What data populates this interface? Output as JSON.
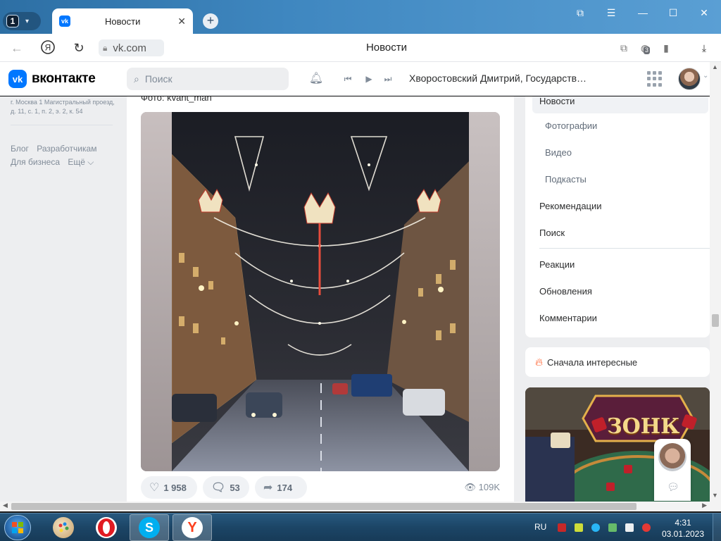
{
  "browser": {
    "tab_count": "1",
    "tab_title": "Новости",
    "tab_close": "✕",
    "new_tab": "+",
    "url_host": "vk.com",
    "page_title": "Новости",
    "extensions_badge": "3"
  },
  "vk_header": {
    "logo_letter": "vk",
    "brand": "вконтакте",
    "search_placeholder": "Поиск",
    "now_playing": "Хворостовский Дмитрий, Государств…"
  },
  "left_column": {
    "address": "г. Москва 1 Магистральный проезд, д. 11, с. 1, п. 2, э. 2, к. 54",
    "links": [
      "Блог",
      "Разработчикам",
      "Для бизнеса",
      "Ещё ⌵"
    ]
  },
  "post": {
    "photo_caption": "Фото: kvant_man",
    "likes": "1 958",
    "comments": "53",
    "shares": "174",
    "views": "109K"
  },
  "right_menu": {
    "items": [
      {
        "label": "Новости"
      },
      {
        "label": "Фотографии"
      },
      {
        "label": "Видео"
      },
      {
        "label": "Подкасты"
      },
      {
        "label": "Рекомендации"
      },
      {
        "label": "Поиск"
      },
      {
        "label": "Реакции"
      },
      {
        "label": "Обновления"
      },
      {
        "label": "Комментарии"
      }
    ],
    "sort_label": "Сначала интересные"
  },
  "ad": {
    "title": "ЗОНК"
  },
  "taskbar": {
    "language": "RU",
    "time": "4:31",
    "date": "03.01.2023"
  },
  "colors": {
    "vk_blue": "#0077ff",
    "vk_bg": "#edeef0",
    "taskbar": "#1c4566"
  }
}
